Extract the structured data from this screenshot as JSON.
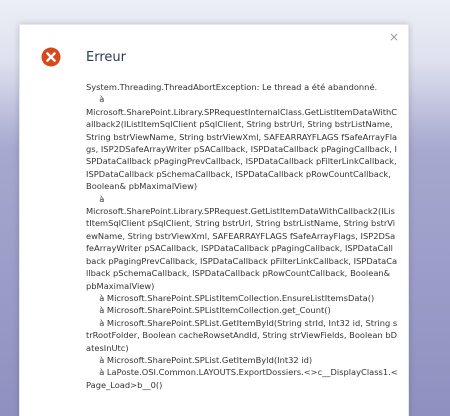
{
  "dialog": {
    "title": "Erreur",
    "close_label": "×",
    "icon": "error-circle-x-icon",
    "icon_color": "#d9481b",
    "message": "System.Threading.ThreadAbortException: Le thread a été abandonné.\n     à\nMicrosoft.SharePoint.Library.SPRequestInternalClass.GetListItemDataWithCallback2(IListItemSqlClient pSqlClient, String bstrUrl, String bstrListName, String bstrViewName, String bstrViewXml, SAFEARRAYFLAGS fSafeArrayFlags, ISP2DSafeArrayWriter pSACallback, ISPDataCallback pPagingCallback, ISPDataCallback pPagingPrevCallback, ISPDataCallback pFilterLinkCallback, ISPDataCallback pSchemaCallback, ISPDataCallback pRowCountCallback, Boolean& pbMaximalView)\n     à\nMicrosoft.SharePoint.Library.SPRequest.GetListItemDataWithCallback2(IListItemSqlClient pSqlClient, String bstrUrl, String bstrListName, String bstrViewName, String bstrViewXml, SAFEARRAYFLAGS fSafeArrayFlags, ISP2DSafeArrayWriter pSACallback, ISPDataCallback pPagingCallback, ISPDataCallback pPagingPrevCallback, ISPDataCallback pFilterLinkCallback, ISPDataCallback pSchemaCallback, ISPDataCallback pRowCountCallback, Boolean& pbMaximalView)\n     à Microsoft.SharePoint.SPListItemCollection.EnsureListItemsData()\n     à Microsoft.SharePoint.SPListItemCollection.get_Count()\n     à Microsoft.SharePoint.SPList.GetItemById(String strId, Int32 id, String strRootFolder, Boolean cacheRowsetAndId, String strViewFields, Boolean bDatesInUtc)\n     à Microsoft.SharePoint.SPList.GetItemById(Int32 id)\n     à LaPoste.OSI.Common.LAYOUTS.ExportDossiers.<>c__DisplayClass1.<Page_Load>b__0()"
  }
}
